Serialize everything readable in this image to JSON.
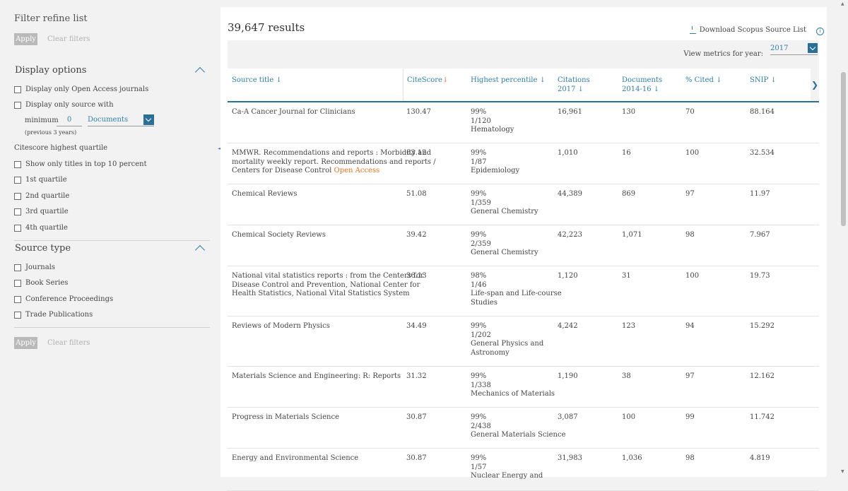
{
  "sidebar": {
    "title": "Filter refine list",
    "apply": "Apply",
    "clear": "Clear filters",
    "display_options": {
      "heading": "Display options",
      "open_access": "Display only Open Access journals",
      "only_source": "Display only source with",
      "minimum_label": "minimum",
      "minimum_value": "0",
      "documents": "Documents",
      "previous": "(previous 3 years)"
    },
    "quartile": {
      "heading": "Citescore highest quartile",
      "items": [
        "Show only titles in top 10 percent",
        "1st quartile",
        "2nd quartile",
        "3rd quartile",
        "4th quartile"
      ]
    },
    "source_type": {
      "heading": "Source type",
      "items": [
        "Journals",
        "Book Series",
        "Conference Proceedings",
        "Trade Publications"
      ]
    }
  },
  "main": {
    "results": "39,647 results",
    "download": "Download Scopus Source List",
    "metrics_label": "View metrics for year:",
    "year": "2017",
    "columns": [
      "Source title",
      "CiteScore",
      "Highest percentile",
      "Citations",
      "2017",
      "Documents",
      "2014-16",
      "% Cited",
      "SNIP"
    ],
    "sort_arrow": "↓",
    "open_access_label": "Open Access",
    "rows": [
      {
        "title": [
          "Ca-A Cancer Journal for Clinicians"
        ],
        "oa": false,
        "citescore": "130.47",
        "pct": [
          "99%",
          "1/120",
          "Hematology"
        ],
        "citations": "16,961",
        "documents": "130",
        "cited": "70",
        "snip": "88.164"
      },
      {
        "title": [
          "MMWR. Recommendations and reports : Morbidity and",
          "mortality weekly report. Recommendations and reports /",
          "Centers for Disease Control"
        ],
        "oa": true,
        "citescore": "63.12",
        "pct": [
          "99%",
          "1/87",
          "Epidemiology"
        ],
        "citations": "1,010",
        "documents": "16",
        "cited": "100",
        "snip": "32.534"
      },
      {
        "title": [
          "Chemical Reviews"
        ],
        "oa": false,
        "citescore": "51.08",
        "pct": [
          "99%",
          "1/359",
          "General Chemistry"
        ],
        "citations": "44,389",
        "documents": "869",
        "cited": "97",
        "snip": "11.97"
      },
      {
        "title": [
          "Chemical Society Reviews"
        ],
        "oa": false,
        "citescore": "39.42",
        "pct": [
          "99%",
          "2/359",
          "General Chemistry"
        ],
        "citations": "42,223",
        "documents": "1,071",
        "cited": "98",
        "snip": "7.967"
      },
      {
        "title": [
          "National vital statistics reports : from the Centers for",
          "Disease Control and Prevention, National Center for",
          "Health Statistics, National Vital Statistics System"
        ],
        "oa": false,
        "citescore": "36.13",
        "pct": [
          "98%",
          "1/46",
          "Life-span and Life-course",
          "Studies"
        ],
        "citations": "1,120",
        "documents": "31",
        "cited": "100",
        "snip": "19.73"
      },
      {
        "title": [
          "Reviews of Modern Physics"
        ],
        "oa": false,
        "citescore": "34.49",
        "pct": [
          "99%",
          "1/202",
          "General Physics and",
          "Astronomy"
        ],
        "citations": "4,242",
        "documents": "123",
        "cited": "94",
        "snip": "15.292"
      },
      {
        "title": [
          "Materials Science and Engineering: R: Reports"
        ],
        "oa": false,
        "citescore": "31.32",
        "pct": [
          "99%",
          "1/338",
          "Mechanics of Materials"
        ],
        "citations": "1,190",
        "documents": "38",
        "cited": "97",
        "snip": "12.162"
      },
      {
        "title": [
          "Progress in Materials Science"
        ],
        "oa": false,
        "citescore": "30.87",
        "pct": [
          "99%",
          "2/438",
          "General Materials Science"
        ],
        "citations": "3,087",
        "documents": "100",
        "cited": "99",
        "snip": "11.742"
      },
      {
        "title": [
          "Energy and Environmental Science"
        ],
        "oa": false,
        "citescore": "30.87",
        "pct": [
          "99%",
          "1/57",
          "Nuclear Energy and"
        ],
        "citations": "31,983",
        "documents": "1,036",
        "cited": "98",
        "snip": "4.819"
      }
    ]
  },
  "colors": {
    "accent": "#2e7fa8",
    "accent_dark": "#2a6f96",
    "open_access": "#e9711c"
  },
  "icons": [
    "download-icon",
    "info-icon",
    "chevron-up-icon",
    "chevron-down-icon",
    "collapse-left-icon",
    "chevron-right-icon"
  ]
}
